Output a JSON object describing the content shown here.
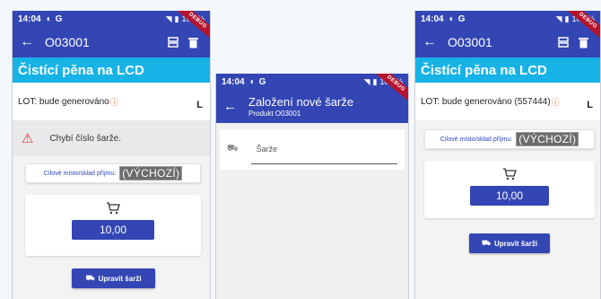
{
  "status": {
    "time": "14:04",
    "battery": "100 %",
    "debug": "DEBUG"
  },
  "left": {
    "title": "O03001",
    "subheader": "Čistící pěna na LCD",
    "lot_text": "LOT: bude generováno",
    "lot_unit": "L",
    "error": "Chybí číslo šarže.",
    "target_label": "Cílové místo/sklad příjmu:",
    "target_value": "(VÝCHOZÍ)",
    "quantity": "10,00",
    "edit_button": "Upravit šarži"
  },
  "middle": {
    "title": "Založení nové šarže",
    "subtitle": "Produkt O03001",
    "input_placeholder": "Šarže"
  },
  "right": {
    "title": "O03001",
    "subheader": "Čistící pěna na LCD",
    "lot_text": "LOT: bude generováno (557444)",
    "lot_unit": "L",
    "target_label": "Cílové místo/sklad příjmu:",
    "target_value": "(VÝCHOZÍ)",
    "quantity": "10,00",
    "edit_button": "Upravit šarži"
  },
  "icons": [
    "back-arrow-icon",
    "list-icon",
    "trash-icon",
    "info-icon",
    "warning-icon",
    "cart-icon",
    "boxes-icon",
    "wifi-icon",
    "battery-icon"
  ],
  "colors": {
    "primary": "#3346b4",
    "accent": "#17b3e6",
    "error": "#e53935",
    "debug": "#b5132e"
  }
}
